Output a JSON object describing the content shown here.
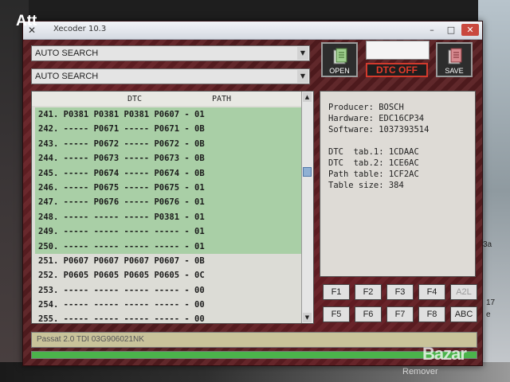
{
  "overlay_label": "Att",
  "window": {
    "title": "Xecoder 10.3"
  },
  "combos": [
    {
      "value": "AUTO SEARCH"
    },
    {
      "value": "AUTO SEARCH"
    }
  ],
  "toolbar": {
    "open_label": "OPEN",
    "save_label": "SAVE",
    "dtc_off_label": "DTC OFF"
  },
  "table": {
    "headers": {
      "dtc": "DTC",
      "path": "PATH"
    },
    "rows": [
      {
        "num": "241.",
        "c1": "P0381",
        "c2": "P0381",
        "c3": "P0381",
        "c4": "P0607",
        "path": "01",
        "selected": true
      },
      {
        "num": "242.",
        "c1": "-----",
        "c2": "P0671",
        "c3": "-----",
        "c4": "P0671",
        "path": "0B",
        "selected": true
      },
      {
        "num": "243.",
        "c1": "-----",
        "c2": "P0672",
        "c3": "-----",
        "c4": "P0672",
        "path": "0B",
        "selected": true
      },
      {
        "num": "244.",
        "c1": "-----",
        "c2": "P0673",
        "c3": "-----",
        "c4": "P0673",
        "path": "0B",
        "selected": true
      },
      {
        "num": "245.",
        "c1": "-----",
        "c2": "P0674",
        "c3": "-----",
        "c4": "P0674",
        "path": "0B",
        "selected": true
      },
      {
        "num": "246.",
        "c1": "-----",
        "c2": "P0675",
        "c3": "-----",
        "c4": "P0675",
        "path": "01",
        "selected": true
      },
      {
        "num": "247.",
        "c1": "-----",
        "c2": "P0676",
        "c3": "-----",
        "c4": "P0676",
        "path": "01",
        "selected": true
      },
      {
        "num": "248.",
        "c1": "-----",
        "c2": "-----",
        "c3": "-----",
        "c4": "P0381",
        "path": "01",
        "selected": true
      },
      {
        "num": "249.",
        "c1": "-----",
        "c2": "-----",
        "c3": "-----",
        "c4": "-----",
        "path": "01",
        "selected": true
      },
      {
        "num": "250.",
        "c1": "-----",
        "c2": "-----",
        "c3": "-----",
        "c4": "-----",
        "path": "01",
        "selected": true
      },
      {
        "num": "251.",
        "c1": "P0607",
        "c2": "P0607",
        "c3": "P0607",
        "c4": "P0607",
        "path": "0B",
        "selected": false
      },
      {
        "num": "252.",
        "c1": "P0605",
        "c2": "P0605",
        "c3": "P0605",
        "c4": "P0605",
        "path": "0C",
        "selected": false
      },
      {
        "num": "253.",
        "c1": "-----",
        "c2": "-----",
        "c3": "-----",
        "c4": "-----",
        "path": "00",
        "selected": false
      },
      {
        "num": "254.",
        "c1": "-----",
        "c2": "-----",
        "c3": "-----",
        "c4": "-----",
        "path": "00",
        "selected": false
      },
      {
        "num": "255.",
        "c1": "-----",
        "c2": "-----",
        "c3": "-----",
        "c4": "-----",
        "path": "00",
        "selected": false
      }
    ]
  },
  "info": {
    "producer": "Producer: BOSCH",
    "hardware": "Hardware: EDC16CP34",
    "software": "Software: 1037393514",
    "dtc_tab1": "DTC  tab.1: 1CDAAC",
    "dtc_tab2": "DTC  tab.2: 1CE6AC",
    "path_table": "Path table: 1CF2AC",
    "table_size": "Table size: 384"
  },
  "fkeys": [
    "F1",
    "F2",
    "F3",
    "F4",
    "A2L",
    "F5",
    "F6",
    "F7",
    "F8",
    "ABC"
  ],
  "status_text": "Passat 2.0 TDI 03G906021NK",
  "progress": 1.0,
  "background": {
    "side_fragments": [
      "3a",
      "17",
      "e"
    ],
    "bottom_word": "Remover",
    "watermark": "Bazar"
  }
}
